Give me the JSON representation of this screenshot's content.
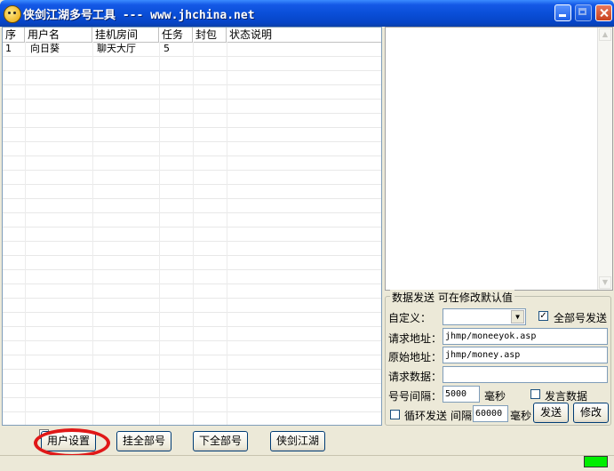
{
  "window": {
    "title": "侠剑江湖多号工具 --- www.jhchina.net",
    "app_icon": "smiley-face-icon"
  },
  "list": {
    "columns": [
      "序",
      "用户名",
      "挂机房间",
      "任务",
      "封包",
      "状态说明"
    ],
    "rows": [
      {
        "index": "1",
        "username": "向日葵",
        "room": "聊天大厅",
        "task": "5",
        "packet": "",
        "status": ""
      }
    ]
  },
  "send_panel": {
    "title": "数据发送 可在修改默认值",
    "custom_label": "自定义：",
    "custom_value": "",
    "send_all_label": "全部号发送",
    "send_all_checked": true,
    "request_url_label": "请求地址：",
    "request_url_value": "jhmp/moneeyok.asp",
    "original_url_label": "原始地址：",
    "original_url_value": "jhmp/money.asp",
    "request_data_label": "请求数据：",
    "request_data_value": "",
    "interval_label": "号号间隔：",
    "interval_value": "5000",
    "interval_unit": "毫秒",
    "speak_data_label": "发言数据",
    "speak_data_checked": false,
    "loop_send_label": "循环发送",
    "loop_send_checked": false,
    "loop_interval_label": "间隔",
    "loop_interval_value": "60000",
    "loop_interval_unit": "毫秒",
    "send_button": "发送",
    "modify_button": "修改"
  },
  "toolbar": {
    "user_settings": "用户设置",
    "hang_all": "挂全部号",
    "unhang_all": "下全部号",
    "xiajian": "侠剑江湖"
  },
  "status": {
    "indicator_color": "#00ee00"
  }
}
